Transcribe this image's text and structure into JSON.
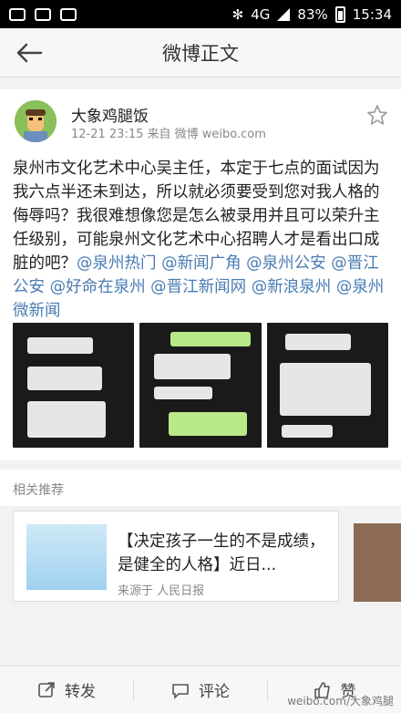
{
  "status": {
    "network": "4G",
    "battery_percent": "83%",
    "time": "15:34"
  },
  "nav": {
    "title": "微博正文"
  },
  "post": {
    "username": "大象鸡腿饭",
    "meta": "12-21 23:15  来自 微博 weibo.com",
    "text": "泉州市文化艺术中心吴主任，本定于七点的面试因为我六点半还未到达，所以就必须要受到您对我人格的侮辱吗？我很难想像您是怎么被录用并且可以荣升主任级别，可能泉州文化艺术中心招聘人才是看出口成脏的吧？",
    "mentions": [
      "@泉州热门",
      "@新闻广角",
      "@泉州公安",
      "@晋江公安",
      "@好命在泉州",
      "@晋江新闻网",
      "@新浪泉州",
      "@泉州微新闻"
    ]
  },
  "related": {
    "heading": "相关推荐",
    "title": "【决定孩子一生的不是成绩，是健全的人格】近日...",
    "source": "来源于 人民日报"
  },
  "actions": {
    "repost": "转发",
    "comment": "评论",
    "like": "赞"
  },
  "watermark": "weibo.com/大象鸡腿"
}
